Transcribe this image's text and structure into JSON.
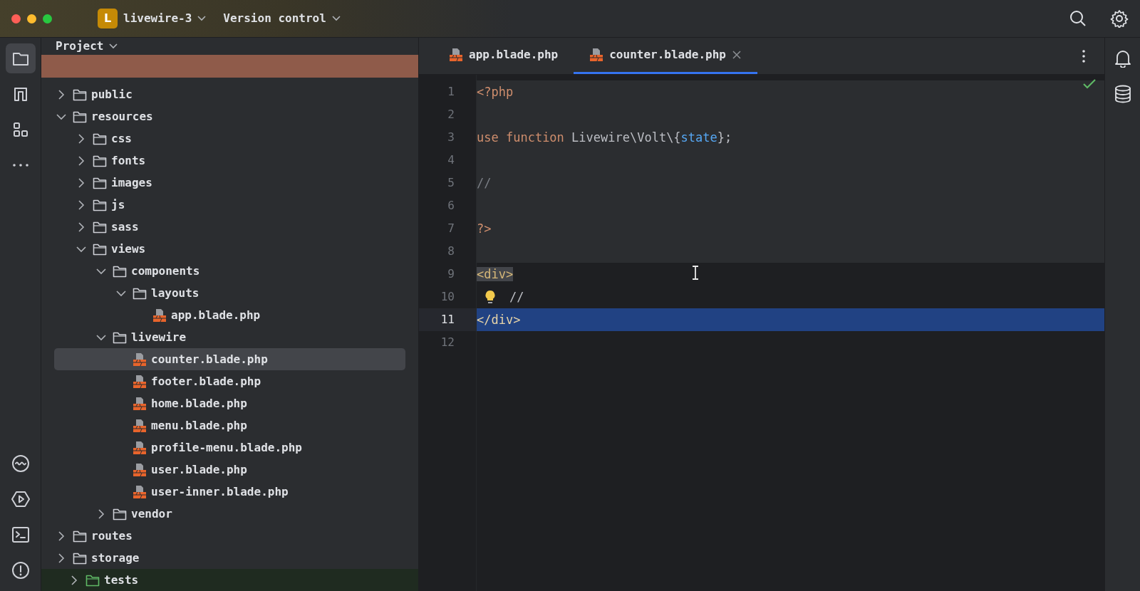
{
  "title_bar": {
    "project_badge": "L",
    "project_name": "livewire-3",
    "vcs_menu": "Version control"
  },
  "left_toolbar": {
    "top": [
      {
        "kind": "folder",
        "selected": true
      },
      {
        "kind": "structure",
        "selected": false
      },
      {
        "kind": "components",
        "selected": false
      },
      {
        "kind": "more",
        "selected": false
      }
    ],
    "bottom": [
      {
        "kind": "wave"
      },
      {
        "kind": "run"
      },
      {
        "kind": "terminal"
      },
      {
        "kind": "problems"
      }
    ]
  },
  "project_panel": {
    "title": "Project"
  },
  "project_tree": {
    "items": [
      {
        "name": "public",
        "kind": "folder",
        "expanded": false,
        "selected": false
      },
      {
        "name": "resources",
        "kind": "folder",
        "expanded": true,
        "selected": false,
        "children": [
          {
            "name": "css",
            "kind": "folder",
            "expanded": false,
            "selected": false
          },
          {
            "name": "fonts",
            "kind": "folder",
            "expanded": false,
            "selected": false
          },
          {
            "name": "images",
            "kind": "folder",
            "expanded": false,
            "selected": false
          },
          {
            "name": "js",
            "kind": "folder",
            "expanded": false,
            "selected": false
          },
          {
            "name": "sass",
            "kind": "folder",
            "expanded": false,
            "selected": false
          },
          {
            "name": "views",
            "kind": "folder",
            "expanded": true,
            "selected": false,
            "children": [
              {
                "name": "components",
                "kind": "folder",
                "expanded": true,
                "selected": false,
                "children": [
                  {
                    "name": "layouts",
                    "kind": "folder",
                    "expanded": true,
                    "selected": false,
                    "children": [
                      {
                        "name": "app.blade.php",
                        "kind": "file",
                        "selected": false
                      }
                    ]
                  }
                ]
              },
              {
                "name": "livewire",
                "kind": "folder",
                "expanded": true,
                "selected": false,
                "children": [
                  {
                    "name": "counter.blade.php",
                    "kind": "file",
                    "selected": true
                  },
                  {
                    "name": "footer.blade.php",
                    "kind": "file",
                    "selected": false
                  },
                  {
                    "name": "home.blade.php",
                    "kind": "file",
                    "selected": false
                  },
                  {
                    "name": "menu.blade.php",
                    "kind": "file",
                    "selected": false
                  },
                  {
                    "name": "profile-menu.blade.php",
                    "kind": "file",
                    "selected": false
                  },
                  {
                    "name": "user.blade.php",
                    "kind": "file",
                    "selected": false
                  },
                  {
                    "name": "user-inner.blade.php",
                    "kind": "file",
                    "selected": false
                  }
                ]
              },
              {
                "name": "vendor",
                "kind": "folder",
                "expanded": false,
                "selected": false
              }
            ]
          }
        ]
      },
      {
        "name": "routes",
        "kind": "folder",
        "expanded": false,
        "selected": false
      },
      {
        "name": "storage",
        "kind": "folder",
        "expanded": false,
        "selected": false
      },
      {
        "name": "tests",
        "kind": "test-folder",
        "expanded": false,
        "selected": false
      }
    ]
  },
  "editor": {
    "tabs": [
      {
        "label": "app.blade.php",
        "selected": false
      },
      {
        "label": "counter.blade.php",
        "selected": true
      }
    ],
    "lines": [
      {
        "number": "1",
        "injected": true,
        "selected": false,
        "tokens": [
          {
            "text": "<?php",
            "kind": "keyword"
          }
        ]
      },
      {
        "number": "2",
        "injected": true,
        "selected": false
      },
      {
        "number": "3",
        "injected": true,
        "selected": false,
        "tokens": [
          {
            "text": "use ",
            "kind": "keyword"
          },
          {
            "text": "function",
            "kind": "keyword"
          },
          {
            "text": " Livewire\\Volt\\{",
            "kind": "plain"
          },
          {
            "text": "state",
            "kind": "function"
          },
          {
            "text": "};",
            "kind": "plain"
          }
        ]
      },
      {
        "number": "4",
        "injected": true,
        "selected": false
      },
      {
        "number": "5",
        "injected": true,
        "selected": false,
        "tokens": [
          {
            "text": "//",
            "kind": "comment"
          }
        ]
      },
      {
        "number": "6",
        "injected": true,
        "selected": false
      },
      {
        "number": "7",
        "injected": true,
        "selected": false,
        "tokens": [
          {
            "text": "?>",
            "kind": "keyword"
          }
        ]
      },
      {
        "number": "8",
        "injected": true,
        "selected": false
      },
      {
        "number": "9",
        "injected": false,
        "selected": false,
        "tokens": [
          {
            "text": "<div>",
            "kind": "tag",
            "matched": true
          }
        ]
      },
      {
        "number": "10",
        "injected": false,
        "selected": false,
        "bulb": true,
        "tokens": [
          {
            "text": "//",
            "kind": "plain"
          }
        ]
      },
      {
        "number": "11",
        "injected": false,
        "selected": true,
        "tokens": [
          {
            "text": "</div>",
            "kind": "tag"
          }
        ]
      },
      {
        "number": "12",
        "injected": false,
        "selected": false
      }
    ]
  }
}
